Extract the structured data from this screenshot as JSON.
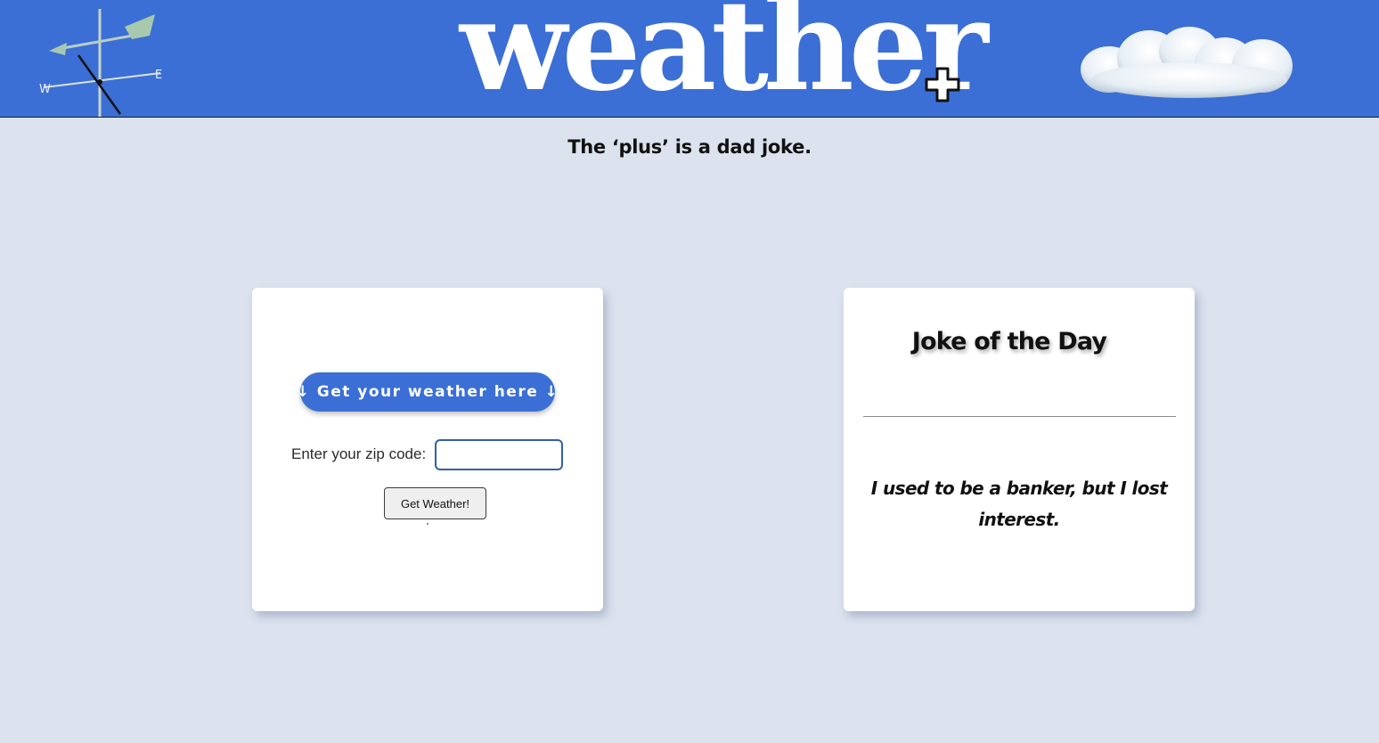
{
  "header": {
    "logo_text": "weather",
    "plus_icon": "plus-icon",
    "vane_icon": "weather-vane-icon",
    "cloud_icon": "cloud-icon",
    "background_color": "#3b6fd6"
  },
  "tagline": "The ‘plus’ is a dad joke.",
  "weather_card": {
    "pill_label": "↓ Get your weather here ↓",
    "zip_label": "Enter your zip code:",
    "zip_value": "",
    "button_label": "Get Weather!"
  },
  "joke_card": {
    "title": "Joke of the Day",
    "joke": "I used to be a banker, but I lost interest."
  },
  "colors": {
    "accent": "#3b6fd6",
    "page_background": "#dce2ee",
    "card_background": "#ffffff"
  }
}
